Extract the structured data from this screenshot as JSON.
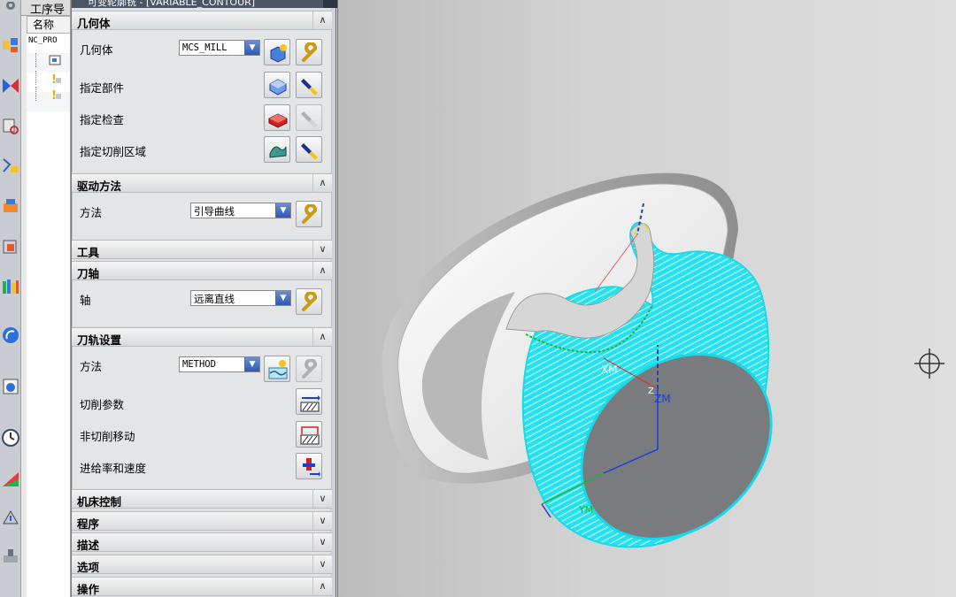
{
  "navigator": {
    "title": "工序导",
    "column_name": "名称",
    "root_item": "NC_PRO"
  },
  "dialog": {
    "title": "可变轮廓铣 - [VARIABLE_CONTOUR]",
    "sections": {
      "geometry": {
        "title": "几何体",
        "expanded": true,
        "geometry_label": "几何体",
        "geometry_value": "MCS_MILL",
        "part_label": "指定部件",
        "check_label": "指定检查",
        "cut_area_label": "指定切削区域"
      },
      "drive": {
        "title": "驱动方法",
        "expanded": true,
        "method_label": "方法",
        "method_value": "引导曲线"
      },
      "tool": {
        "title": "工具",
        "expanded": false
      },
      "axis": {
        "title": "刀轴",
        "expanded": true,
        "axis_label": "轴",
        "axis_value": "远离直线"
      },
      "path": {
        "title": "刀轨设置",
        "expanded": true,
        "method_label": "方法",
        "method_value": "METHOD",
        "cut_params_label": "切削参数",
        "non_cut_label": "非切削移动",
        "feeds_label": "进给率和速度"
      },
      "machine": {
        "title": "机床控制",
        "expanded": false
      },
      "program": {
        "title": "程序",
        "expanded": false
      },
      "description": {
        "title": "描述",
        "expanded": false
      },
      "options": {
        "title": "选项",
        "expanded": false
      },
      "actions": {
        "title": "操作",
        "expanded": true
      }
    },
    "expand_glyph": "∨",
    "collapse_glyph": "∧",
    "dropdown_glyph": "▼"
  },
  "viewport": {
    "labels": {
      "xm": "XM",
      "zm": "ZM",
      "z": "Z",
      "ym": "YM"
    },
    "colors": {
      "toolpath": "#19d9e8",
      "body_light": "#f3f3f3",
      "body_dark": "#a9a9a9",
      "end_face": "#7a7b7f",
      "axis_blue": "#1a3fd8",
      "axis_green": "#1bb53a",
      "axis_red": "#e03030",
      "accent_yellow": "#e8e020"
    }
  }
}
